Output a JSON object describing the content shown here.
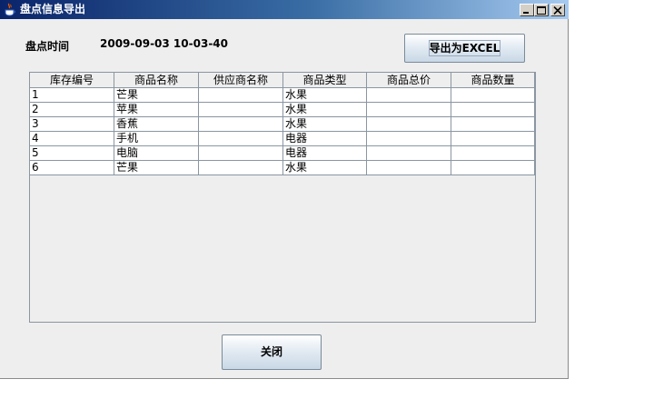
{
  "window": {
    "title": "盘点信息导出",
    "icon": "java-cup-icon",
    "controls": [
      "minimize-icon",
      "maximize-icon",
      "close-icon"
    ]
  },
  "info": {
    "time_label": "盘点时间",
    "time_value": "2009-09-03 10-03-40"
  },
  "buttons": {
    "export_label": "导出为EXCEL",
    "close_label": "关闭"
  },
  "table": {
    "columns": [
      "库存编号",
      "商品名称",
      "供应商名称",
      "商品类型",
      "商品总价",
      "商品数量"
    ],
    "rows": [
      [
        "1",
        "芒果",
        "",
        "水果",
        "",
        ""
      ],
      [
        "2",
        "苹果",
        "",
        "水果",
        "",
        ""
      ],
      [
        "3",
        "香蕉",
        "",
        "水果",
        "",
        ""
      ],
      [
        "4",
        "手机",
        "",
        "电器",
        "",
        ""
      ],
      [
        "5",
        "电脑",
        "",
        "电器",
        "",
        ""
      ],
      [
        "6",
        "芒果",
        "",
        "水果",
        "",
        ""
      ]
    ]
  }
}
